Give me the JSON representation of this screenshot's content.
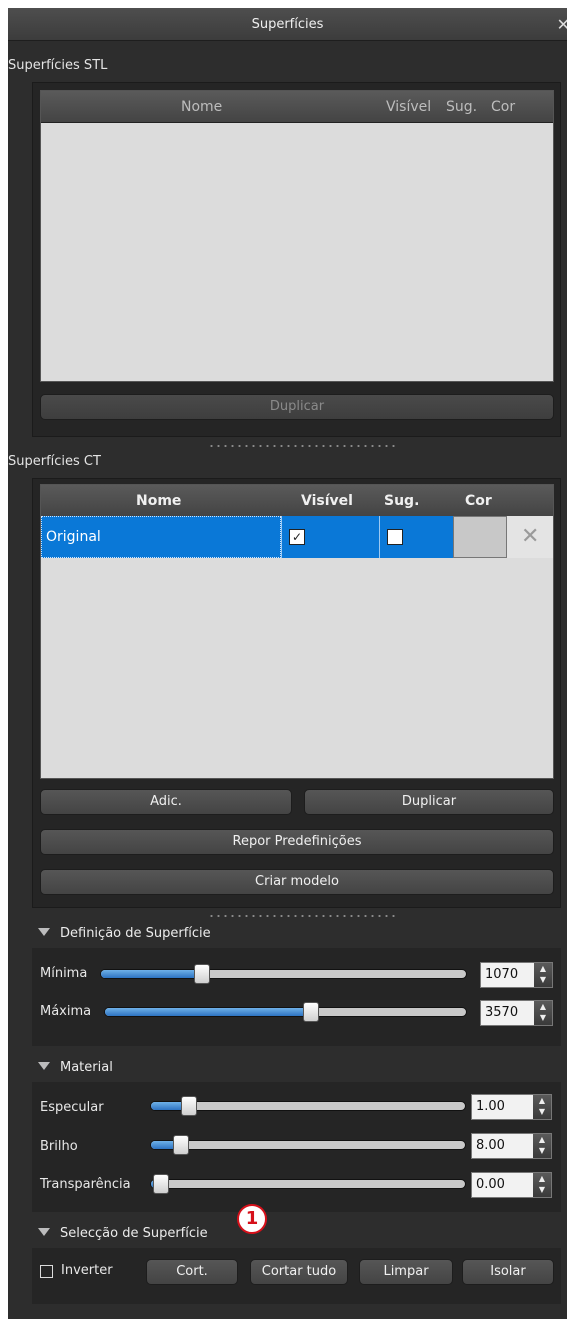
{
  "window": {
    "title": "Superfícies",
    "close_icon": "close-icon"
  },
  "stl": {
    "section_label": "Superfícies STL",
    "columns": [
      "Nome",
      "Visível",
      "Sug.",
      "Cor"
    ],
    "duplicate_label": "Duplicar"
  },
  "ct": {
    "section_label": "Superfícies CT",
    "columns": [
      "Nome",
      "Visível",
      "Sug.",
      "Cor"
    ],
    "rows": [
      {
        "name": "Original",
        "visible": true,
        "sug": false,
        "color": "#c8c8c8"
      }
    ],
    "add_label": "Adic.",
    "duplicate_label": "Duplicar",
    "reset_label": "Repor Predefinições",
    "create_model_label": "Criar modelo"
  },
  "surface_def": {
    "title": "Definição de Superfície",
    "min_label": "Mínima",
    "min_value": "1070",
    "max_label": "Máxima",
    "max_value": "3570"
  },
  "material": {
    "title": "Material",
    "specular_label": "Especular",
    "specular_value": "1.00",
    "gloss_label": "Brilho",
    "gloss_value": "8.00",
    "transparency_label": "Transparência",
    "transparency_value": "0.00"
  },
  "selection": {
    "title": "Selecção de Superfície",
    "callout_number": "1",
    "invert_label": "Inverter",
    "cut_label": "Cort.",
    "cut_all_label": "Cortar tudo",
    "clear_label": "Limpar",
    "isolate_label": "Isolar"
  },
  "colors": {
    "selection_blue": "#0a78d7",
    "panel_bg": "#2d2d2d",
    "callout_red": "#d6101a"
  }
}
